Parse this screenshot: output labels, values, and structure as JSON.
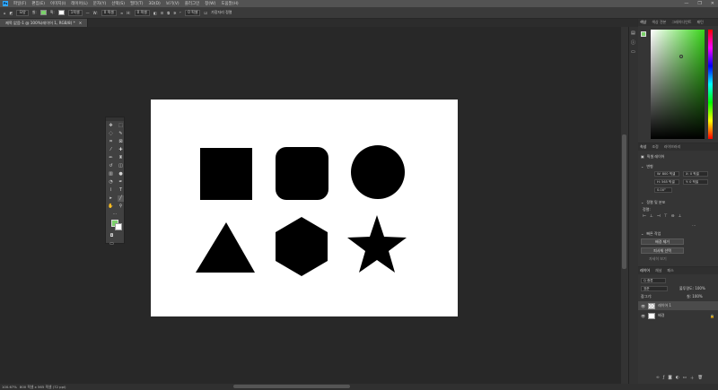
{
  "menu": {
    "logo": "Ps",
    "items": [
      "파일(F)",
      "편집(E)",
      "이미지(I)",
      "레이어(L)",
      "문자(Y)",
      "선택(S)",
      "필터(T)",
      "3D(D)",
      "보기(V)",
      "플러그인",
      "창(W)",
      "도움말(H)"
    ],
    "minimize": "—",
    "restore": "❐",
    "close": "✕"
  },
  "options": {
    "shape_mode": "모양",
    "fill_label": "칠:",
    "stroke_label": "획:",
    "stroke_width": "1픽셀",
    "w_label": "W:",
    "w_value": "0 픽셀",
    "h_label": "H:",
    "h_value": "0 픽셀",
    "radius_value": "0 픽셀",
    "align_edges": "가장자리 정렬"
  },
  "document": {
    "tab_title": "제목 없음-1 @ 100%(레이어 1, RGB/8) *",
    "zoom": "100.67%",
    "dimensions": "800 픽셀 x 565 픽셀 (72 ppi)"
  },
  "panels": {
    "color_tabs": [
      "색상",
      "색상 견본",
      "그레이디언트",
      "패턴"
    ],
    "props_tabs": [
      "속성",
      "조정",
      "라이브러리"
    ],
    "pixel_layer": "픽셀 레이어",
    "transform": "변형",
    "w_field": "W: 800 픽셀",
    "h_field": "H: 565 픽셀",
    "x_field": "X: 0 픽셀",
    "y_field": "Y: 0 픽셀",
    "angle_field": "0.00°",
    "align": "정렬 및 분포",
    "align_sub": "정렬:",
    "quick_actions": "빠른 작업",
    "qa_btn1": "배경 제거",
    "qa_btn2": "피사체 선택",
    "qa_more": "자세히 보기",
    "layers_tabs": [
      "레이어",
      "채널",
      "패스"
    ],
    "kind": "Q 종류",
    "blend": "표준",
    "opacity": "불투명도: 100%",
    "lock": "잠그기:",
    "fill": "칠: 100%",
    "layers": [
      {
        "name": "레이어 1"
      },
      {
        "name": "배경"
      }
    ]
  },
  "colors": {
    "foreground": "#7ad06a",
    "background": "#ffffff",
    "accent": "#31a8ff"
  }
}
